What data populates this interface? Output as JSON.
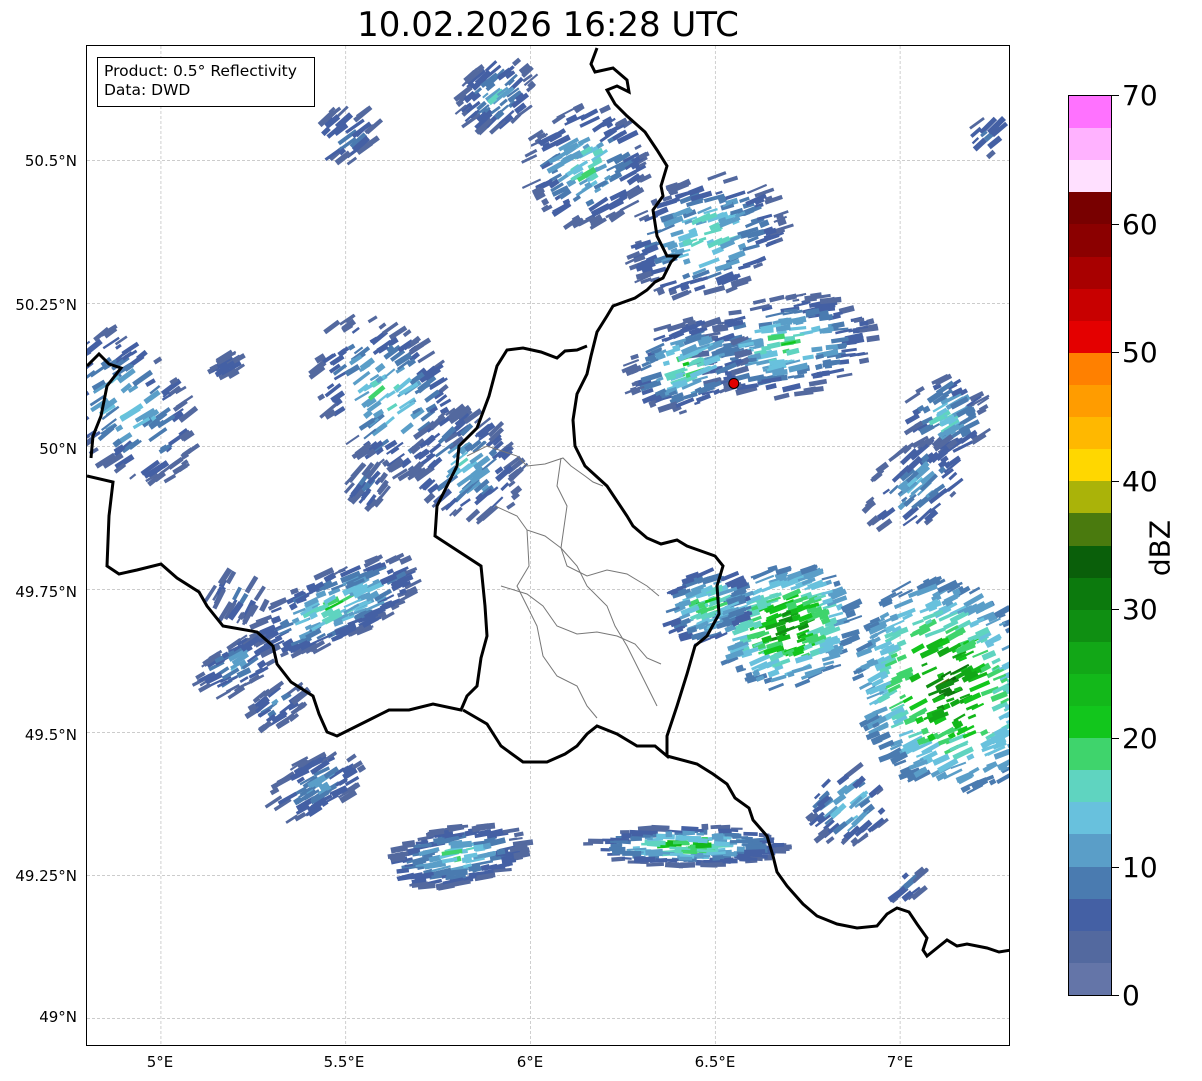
{
  "title": "10.02.2026 16:28 UTC",
  "info": {
    "product": "Product: 0.5° Reflectivity",
    "data": "Data: DWD"
  },
  "lat_labels": [
    "50.5°N",
    "50.25°N",
    "50°N",
    "49.75°N",
    "49.5°N",
    "49.25°N",
    "49°N"
  ],
  "lon_labels": [
    "5°E",
    "5.5°E",
    "6°E",
    "6.5°E",
    "7°E"
  ],
  "colorbar": {
    "label": "dBZ",
    "ticks": [
      "0",
      "10",
      "20",
      "30",
      "40",
      "50",
      "60",
      "70"
    ],
    "range": [
      0,
      70
    ],
    "step": 2.5,
    "colors": [
      "#6475a8",
      "#53699f",
      "#4460a4",
      "#4a7bb0",
      "#5a9ec8",
      "#68c1dd",
      "#5fd4c0",
      "#3fd46c",
      "#12c61c",
      "#13b81a",
      "#12a717",
      "#0f8f12",
      "#0c7a0d",
      "#0a5f0a",
      "#4a7a0e",
      "#aab309",
      "#ffd700",
      "#ffb800",
      "#ff9c00",
      "#ff8000",
      "#e40000",
      "#c80000",
      "#a80000",
      "#8b0000",
      "#780000",
      "#ffe0ff",
      "#ffb2ff",
      "#ff72ff",
      "#ee36ee"
    ]
  },
  "extent": {
    "lon": [
      4.8,
      7.3
    ],
    "lat": [
      48.95,
      50.7
    ]
  },
  "radar_site": {
    "lon": 6.55,
    "lat": 50.11,
    "color": "#e00000"
  }
}
